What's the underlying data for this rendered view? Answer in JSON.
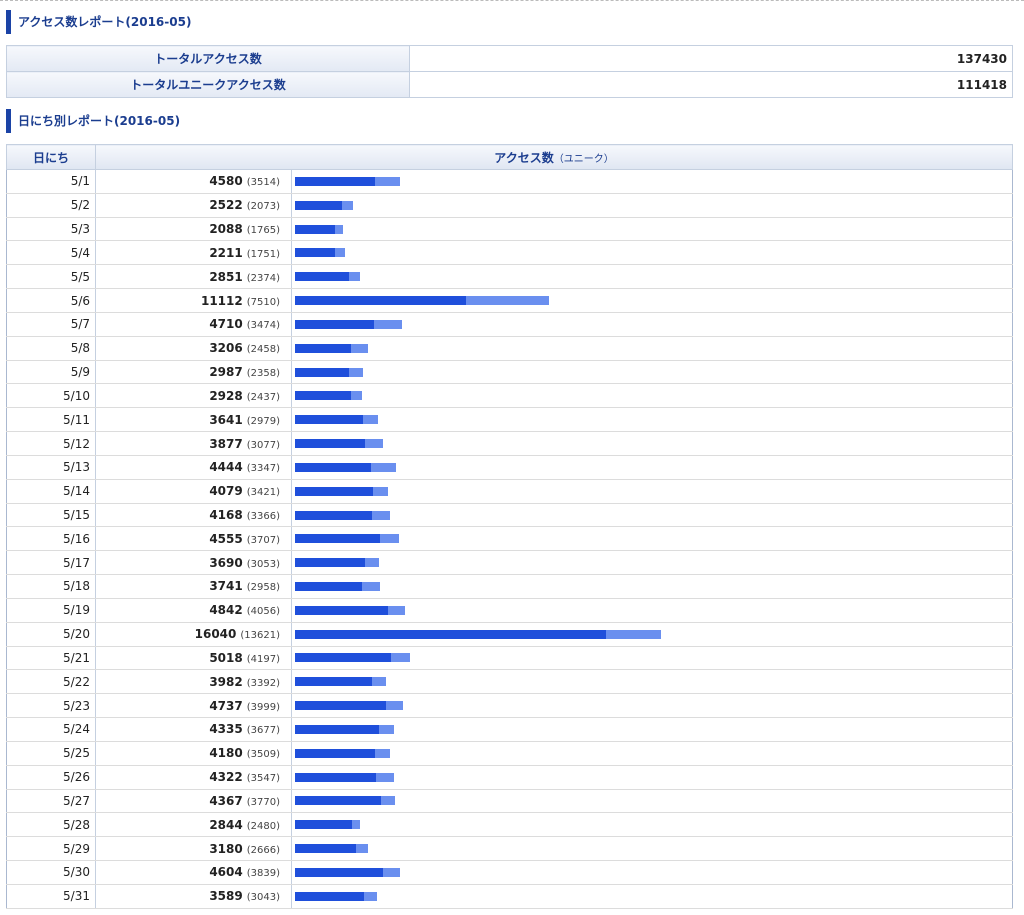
{
  "report_title": "アクセス数レポート(2016-05)",
  "summary": [
    {
      "label": "トータルアクセス数",
      "value": "137430"
    },
    {
      "label": "トータルユニークアクセス数",
      "value": "111418"
    }
  ],
  "daily_title": "日にち別レポート(2016-05)",
  "daily_headers": {
    "day": "日にち",
    "access": "アクセス数",
    "access_sub": "（ユニーク）"
  },
  "colors": {
    "total_bar": "#6a8fef",
    "unique_bar": "#1f4fdb",
    "accent": "#1b43a6"
  },
  "chart_data": {
    "type": "bar",
    "categories": [
      "5/1",
      "5/2",
      "5/3",
      "5/4",
      "5/5",
      "5/6",
      "5/7",
      "5/8",
      "5/9",
      "5/10",
      "5/11",
      "5/12",
      "5/13",
      "5/14",
      "5/15",
      "5/16",
      "5/17",
      "5/18",
      "5/19",
      "5/20",
      "5/21",
      "5/22",
      "5/23",
      "5/24",
      "5/25",
      "5/26",
      "5/27",
      "5/28",
      "5/29",
      "5/30",
      "5/31"
    ],
    "series": [
      {
        "values": [
          4580,
          2522,
          2088,
          2211,
          2851,
          11112,
          4710,
          3206,
          2987,
          2928,
          3641,
          3877,
          4444,
          4079,
          4168,
          4555,
          3690,
          3741,
          4842,
          16040,
          5018,
          3982,
          4737,
          4335,
          4180,
          4322,
          4367,
          2844,
          3180,
          4604,
          3589
        ]
      },
      {
        "values": [
          3514,
          2073,
          1765,
          1751,
          2374,
          7510,
          3474,
          2458,
          2358,
          2437,
          2979,
          3077,
          3347,
          3421,
          3366,
          3707,
          3053,
          2958,
          4056,
          13621,
          4197,
          3392,
          3999,
          3677,
          3509,
          3547,
          3770,
          2480,
          2666,
          3839,
          3043
        ]
      }
    ]
  }
}
